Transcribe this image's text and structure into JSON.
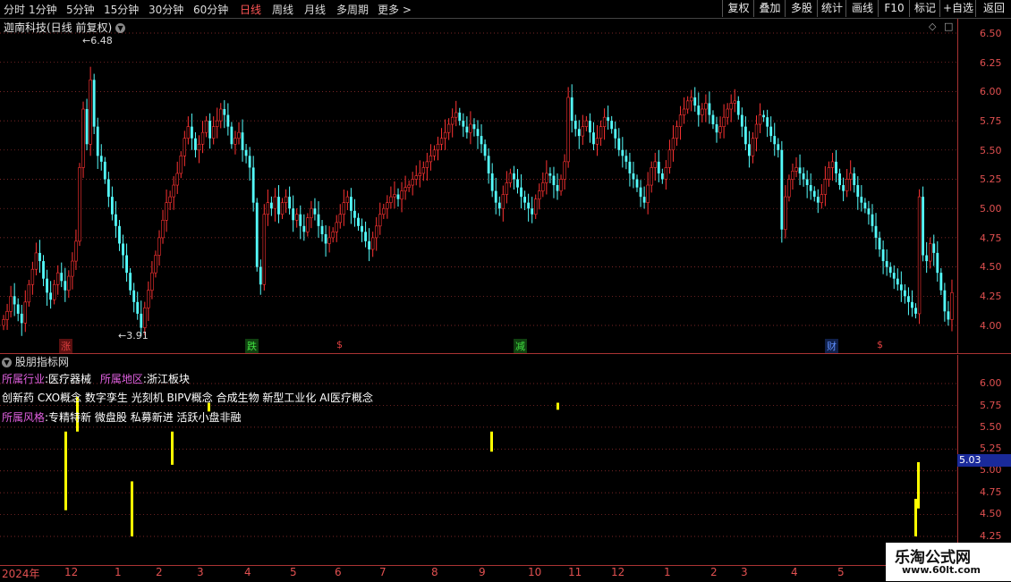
{
  "toolbar": {
    "periods": [
      "分时",
      "1分钟",
      "5分钟",
      "15分钟",
      "30分钟",
      "60分钟",
      "日线",
      "周线",
      "月线",
      "多周期",
      "更多 >"
    ],
    "active_period": "日线",
    "buttons": [
      "复权",
      "叠加",
      "多股",
      "统计",
      "画线",
      "F10",
      "标记",
      "+自选",
      "返回"
    ]
  },
  "chart_title": "迦南科技(日线 前复权)",
  "price_axis": [
    "6.50",
    "6.25",
    "6.00",
    "5.75",
    "5.50",
    "5.25",
    "5.00",
    "4.75",
    "4.50",
    "4.25",
    "4.00"
  ],
  "annotations": {
    "high": "6.48",
    "low": "3.91"
  },
  "event_markers": [
    {
      "text": "涨",
      "color": "#e04040",
      "bg": "#5a1010"
    },
    {
      "text": "跌",
      "color": "#40e040",
      "bg": "#104010"
    },
    {
      "text": "$",
      "color": "#e04040",
      "bg": ""
    },
    {
      "text": "减",
      "color": "#40e040",
      "bg": "#104010"
    },
    {
      "text": "财",
      "color": "#6090ff",
      "bg": "#10204a"
    },
    {
      "text": "$",
      "color": "#e04040",
      "bg": ""
    }
  ],
  "indicator_panel": {
    "title": "股朋指标网",
    "industry_label": "所属行业",
    "industry": ":医疗器械",
    "region_label": "所属地区",
    "region": ":浙江板块",
    "concepts": "创新药 CXO概念 数字孪生 光刻机 BIPV概念 合成生物 新型工业化 AI医疗概念",
    "style_label": "所属风格",
    "styles": ":专精特新 微盘股 私募新进 活跃小盘非融",
    "axis": [
      "6.00",
      "5.75",
      "5.50",
      "5.25",
      "5.00",
      "4.75",
      "4.50",
      "4.25"
    ],
    "current_price": "5.03"
  },
  "date_axis": [
    "2024年",
    "12",
    "1",
    "2",
    "3",
    "4",
    "5",
    "6",
    "7",
    "8",
    "9",
    "10",
    "11",
    "12",
    "1",
    "2",
    "3",
    "4",
    "5"
  ],
  "watermark": {
    "name": "乐淘公式网",
    "url": "www.60lt.com"
  },
  "colors": {
    "up": "#ff3333",
    "down": "#54fcfc",
    "grid": "#a33333",
    "bar": "#ffff00"
  },
  "chart_data": {
    "type": "candlestick",
    "title": "迦南科技(日线 前复权)",
    "ylim": [
      3.91,
      6.48
    ],
    "close": [
      4.05,
      4.12,
      4.25,
      4.18,
      4.1,
      4.02,
      4.2,
      4.35,
      4.48,
      4.62,
      4.55,
      4.4,
      4.28,
      4.22,
      4.35,
      4.45,
      4.38,
      4.3,
      4.42,
      4.55,
      4.72,
      5.35,
      5.85,
      5.55,
      6.1,
      5.7,
      5.45,
      5.4,
      5.25,
      5.1,
      4.95,
      4.85,
      4.7,
      4.6,
      4.45,
      4.3,
      4.2,
      4.1,
      3.98,
      4.15,
      4.3,
      4.45,
      4.6,
      4.75,
      4.9,
      5.05,
      5.1,
      5.2,
      5.3,
      5.45,
      5.6,
      5.7,
      5.6,
      5.5,
      5.55,
      5.65,
      5.75,
      5.6,
      5.7,
      5.75,
      5.85,
      5.8,
      5.7,
      5.55,
      5.6,
      5.65,
      5.5,
      5.45,
      5.35,
      5.05,
      4.5,
      4.35,
      4.95,
      5.05,
      5.0,
      5.1,
      4.95,
      5.05,
      5.1,
      5.0,
      4.9,
      4.95,
      4.85,
      4.8,
      4.92,
      5.0,
      4.95,
      4.85,
      4.78,
      4.7,
      4.75,
      4.8,
      4.88,
      4.95,
      5.05,
      5.1,
      4.98,
      4.92,
      4.85,
      4.8,
      4.72,
      4.65,
      4.75,
      4.85,
      4.95,
      5.0,
      5.05,
      5.1,
      5.12,
      5.08,
      5.15,
      5.18,
      5.2,
      5.25,
      5.28,
      5.3,
      5.35,
      5.4,
      5.45,
      5.5,
      5.55,
      5.6,
      5.65,
      5.72,
      5.78,
      5.82,
      5.75,
      5.7,
      5.65,
      5.72,
      5.68,
      5.62,
      5.55,
      5.45,
      5.3,
      5.15,
      5.05,
      5.0,
      5.12,
      5.22,
      5.3,
      5.25,
      5.18,
      5.1,
      5.05,
      5.0,
      4.95,
      5.08,
      5.15,
      5.22,
      5.3,
      5.28,
      5.2,
      5.15,
      5.25,
      5.4,
      5.95,
      5.75,
      5.68,
      5.62,
      5.7,
      5.75,
      5.65,
      5.55,
      5.6,
      5.7,
      5.78,
      5.75,
      5.68,
      5.6,
      5.5,
      5.45,
      5.4,
      5.3,
      5.25,
      5.18,
      5.1,
      5.05,
      5.2,
      5.35,
      5.4,
      5.3,
      5.25,
      5.35,
      5.5,
      5.6,
      5.7,
      5.8,
      5.85,
      5.92,
      5.95,
      5.88,
      5.8,
      5.85,
      5.9,
      5.8,
      5.72,
      5.65,
      5.7,
      5.78,
      5.85,
      5.9,
      5.92,
      5.8,
      5.7,
      5.55,
      5.45,
      5.6,
      5.72,
      5.8,
      5.78,
      5.7,
      5.62,
      5.55,
      5.5,
      4.82,
      5.1,
      5.25,
      5.32,
      5.35,
      5.3,
      5.25,
      5.2,
      5.15,
      5.1,
      5.05,
      5.12,
      5.25,
      5.35,
      5.4,
      5.3,
      5.2,
      5.15,
      5.25,
      5.3,
      5.2,
      5.1,
      5.05,
      5.0,
      4.95,
      4.85,
      4.75,
      4.65,
      4.55,
      4.5,
      4.45,
      4.4,
      4.35,
      4.3,
      4.25,
      4.2,
      4.15,
      4.1,
      5.1,
      4.6,
      4.55,
      4.7,
      4.62,
      4.45,
      4.3,
      4.12,
      4.05,
      4.28
    ]
  }
}
